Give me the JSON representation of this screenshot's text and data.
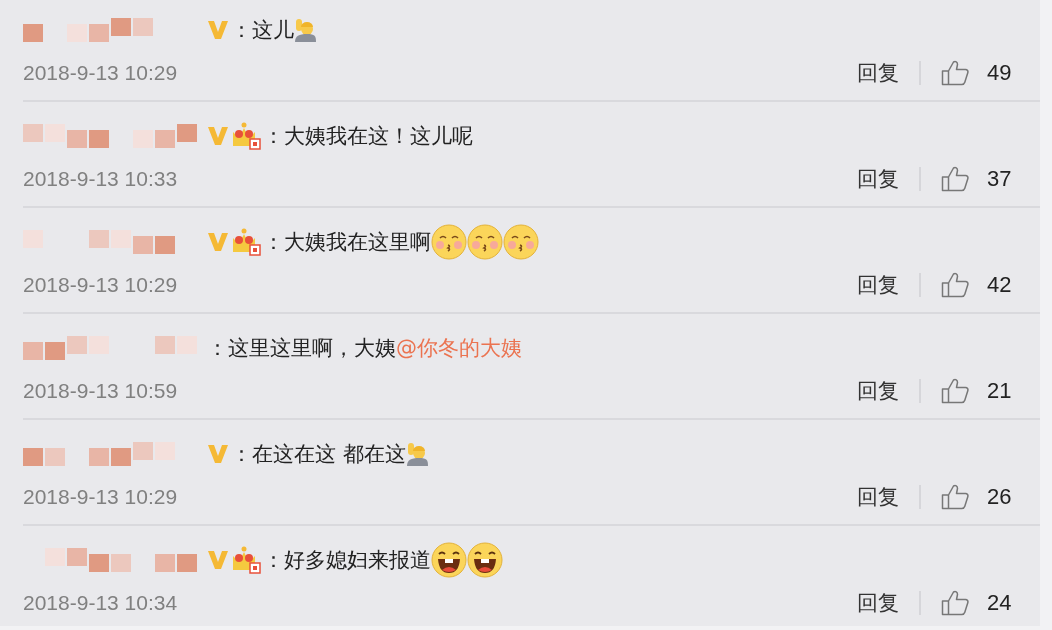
{
  "comments": [
    {
      "badges": [
        {
          "kind": "vip"
        }
      ],
      "content": [
        {
          "kind": "text",
          "text": "：这儿"
        },
        {
          "kind": "raise-hand"
        }
      ],
      "time": "2018-9-13 10:29",
      "reply": "回复",
      "likes": "49"
    },
    {
      "badges": [
        {
          "kind": "vip"
        },
        {
          "kind": "crown"
        }
      ],
      "content": [
        {
          "kind": "text",
          "text": "：大姨我在这！这儿呢"
        }
      ],
      "time": "2018-9-13 10:33",
      "reply": "回复",
      "likes": "37"
    },
    {
      "badges": [
        {
          "kind": "vip"
        },
        {
          "kind": "crown"
        }
      ],
      "content": [
        {
          "kind": "text",
          "text": "：大姨我在这里啊"
        },
        {
          "kind": "kiss"
        },
        {
          "kind": "kiss"
        },
        {
          "kind": "kiss"
        }
      ],
      "time": "2018-9-13 10:29",
      "reply": "回复",
      "likes": "42"
    },
    {
      "content": [
        {
          "kind": "text",
          "text": "：这里这里啊，大姨"
        },
        {
          "kind": "mention",
          "text": "@你冬的大姨"
        }
      ],
      "time": "2018-9-13 10:59",
      "reply": "回复",
      "likes": "21"
    },
    {
      "badges": [
        {
          "kind": "vip"
        }
      ],
      "content": [
        {
          "kind": "text",
          "text": "：在这在这 都在这"
        },
        {
          "kind": "raise-hand"
        }
      ],
      "time": "2018-9-13 10:29",
      "reply": "回复",
      "likes": "26"
    },
    {
      "badges": [
        {
          "kind": "vip"
        },
        {
          "kind": "crown"
        }
      ],
      "content": [
        {
          "kind": "text",
          "text": "：好多媳妇来报道"
        },
        {
          "kind": "laugh"
        },
        {
          "kind": "laugh"
        }
      ],
      "time": "2018-9-13 10:34",
      "reply": "回复",
      "likes": "24"
    }
  ]
}
